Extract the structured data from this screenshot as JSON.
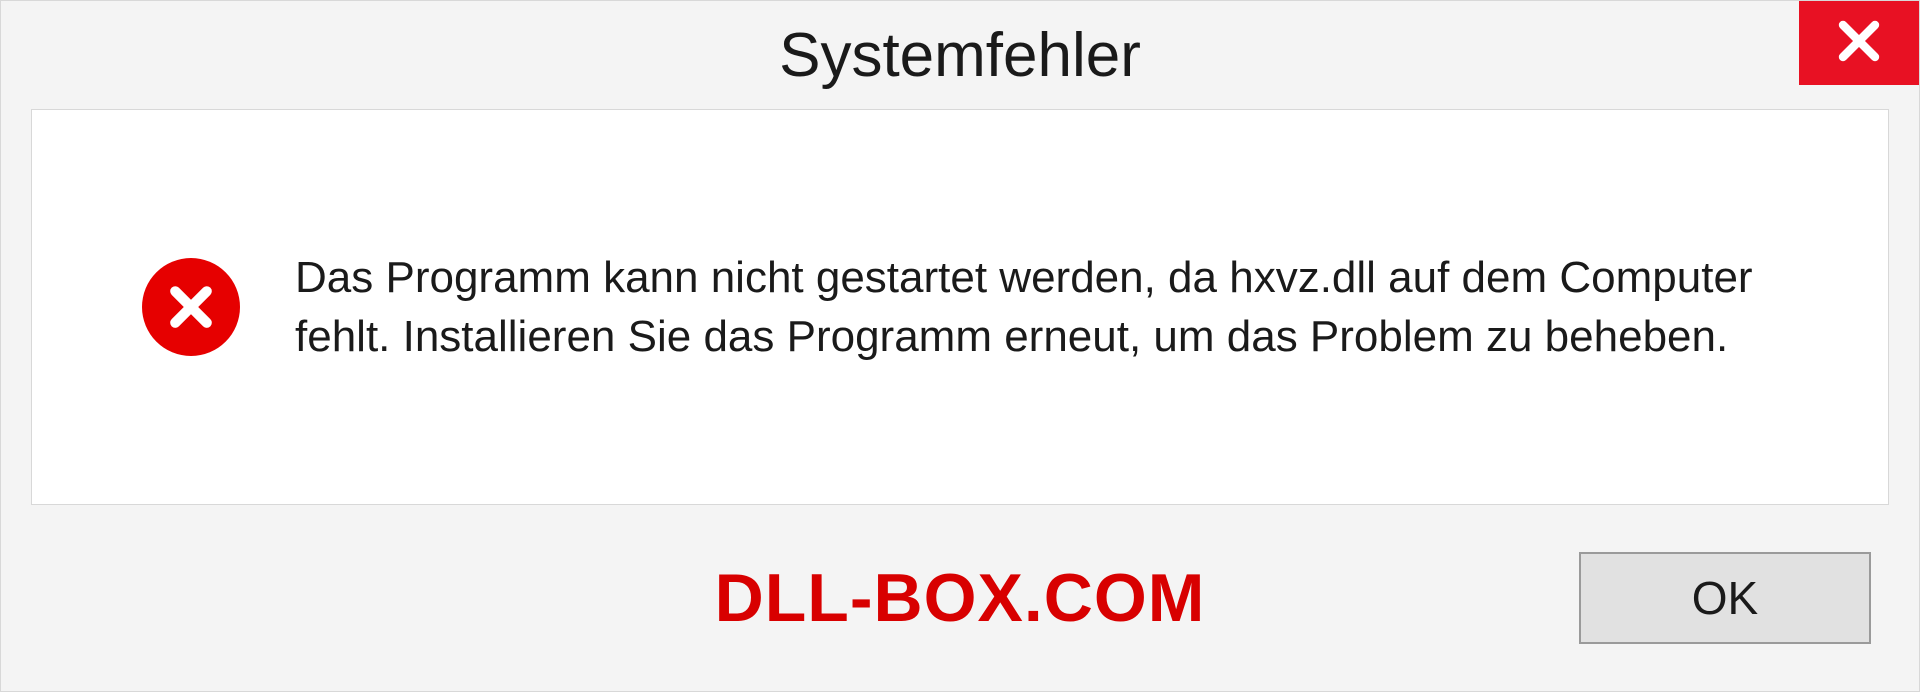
{
  "dialog": {
    "title": "Systemfehler",
    "message": "Das Programm kann nicht gestartet werden, da hxvz.dll auf dem Computer fehlt. Installieren Sie das Programm erneut, um das Problem zu beheben.",
    "ok_label": "OK"
  },
  "watermark": "DLL-BOX.COM"
}
